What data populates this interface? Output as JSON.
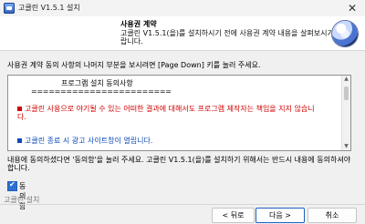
{
  "window": {
    "title": "고클린 V1.5.1 설치",
    "close_glyph": "✕"
  },
  "header": {
    "title": "사용권 계약",
    "subtitle": "고클린 V1.5.1(을)를 설치하시기 전에 사용권 계약 내용을 살펴보시기 바랍니다."
  },
  "instruction": "사용권 계약 동의 사항의 나머지 부분을 보시려면 [Page Down] 키를 눌러 주세요.",
  "license": {
    "heading": "프로그램 설치 동의사항",
    "rule": "========================",
    "items": [
      {
        "text": "고클린 사용으로 야기될 수 있는 어떠한 결과에 대해서도 프로그램 제작자는 책임을 지지 않습니다.",
        "color": "#d00000"
      },
      {
        "text": "고클린 종료 시 광고 사이트창이 열립니다.",
        "color": "#0b48b8"
      }
    ]
  },
  "bottom_text": "내용에 동의하셨다면 '동의함'을 눌러 주세요. 고클린 V1.5.1(을)를 설치하기 위해서는 반드시 내용에 동의하셔야 합니다.",
  "agree": {
    "label": "동의함",
    "checked": true
  },
  "footer": {
    "brand": "고클린 설치"
  },
  "buttons": {
    "back": "< 뒤로",
    "next": "다음 >",
    "cancel": "취소"
  },
  "colors": {
    "accent": "#2d6fd1",
    "warning_text": "#d00000",
    "info_text": "#0b48b8"
  }
}
